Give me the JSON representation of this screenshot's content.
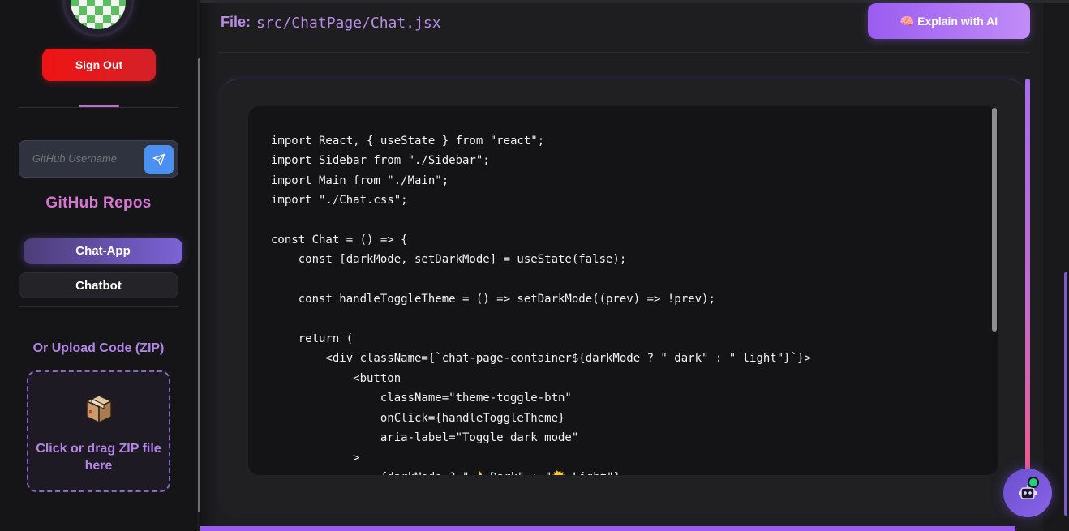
{
  "sidebar": {
    "signout_label": "Sign Out",
    "github_placeholder": "GitHub Username",
    "repos_title": "GitHub Repos",
    "repos": [
      {
        "label": "Chat-App",
        "active": true
      },
      {
        "label": "Chatbot",
        "active": false
      }
    ],
    "upload_title": "Or Upload Code (ZIP)",
    "dropzone_text": "Click or drag ZIP file here"
  },
  "header": {
    "file_label": "File:",
    "file_path": "src/ChatPage/Chat.jsx",
    "explain_label": "🧠 Explain with AI"
  },
  "code": {
    "text": "import React, { useState } from \"react\";\nimport Sidebar from \"./Sidebar\";\nimport Main from \"./Main\";\nimport \"./Chat.css\";\n\nconst Chat = () => {\n    const [darkMode, setDarkMode] = useState(false);\n\n    const handleToggleTheme = () => setDarkMode((prev) => !prev);\n\n    return (\n        <div className={`chat-page-container${darkMode ? \" dark\" : \" light\"}`}>\n            <button\n                className=\"theme-toggle-btn\"\n                onClick={handleToggleTheme}\n                aria-label=\"Toggle dark mode\"\n            >\n                {darkMode ? \"🌙 Dark\" : \"🌞 Light\"}"
  },
  "colors": {
    "accent": "#9b5bf3",
    "signout": "#ef1414",
    "repos_title": "#d776d3",
    "upload": "#b184e6",
    "send_button": "#4b8ff0",
    "status_online": "#1fd07d"
  },
  "icons": {
    "send": "send-icon",
    "box": "package-icon",
    "bot": "robot-icon"
  }
}
